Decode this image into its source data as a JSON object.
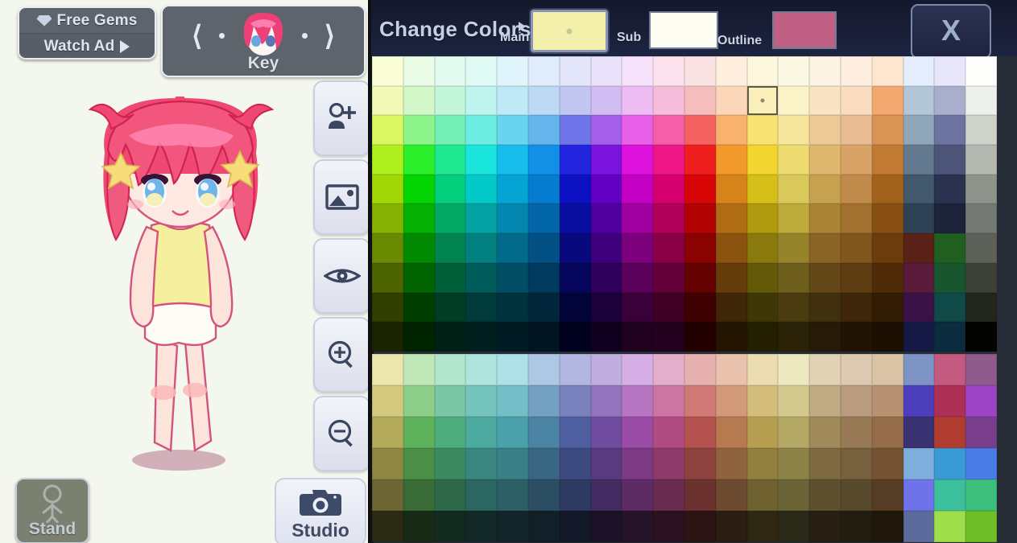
{
  "left_panel": {
    "background_color": "#f4f7ee",
    "free_gems": {
      "label": "Free Gems",
      "sub_label": "Watch Ad",
      "gem_icon": "gem-icon",
      "play_icon": "play-triangle-icon"
    },
    "character_nav": {
      "label": "Key",
      "prev_icon": "chevron-left-icon",
      "next_icon": "chevron-right-icon",
      "avatar_icon": "character-head-avatar"
    },
    "tools": [
      {
        "name": "add-character-button",
        "icon": "person-add-icon"
      },
      {
        "name": "background-image-button",
        "icon": "image-icon"
      },
      {
        "name": "preview-eye-button",
        "icon": "eye-icon"
      },
      {
        "name": "zoom-in-button",
        "icon": "zoom-in-icon"
      },
      {
        "name": "zoom-out-button",
        "icon": "zoom-out-icon"
      }
    ],
    "stand_button": {
      "label": "Stand",
      "icon": "standing-pose-icon"
    },
    "studio_button": {
      "label": "Studio",
      "icon": "camera-icon"
    }
  },
  "color_panel": {
    "title": "Change Colors",
    "close_label": "X",
    "slots": [
      {
        "key": "main",
        "label": "Main",
        "color": "#f3f0ab",
        "selected": true
      },
      {
        "key": "sub",
        "label": "Sub",
        "color": "#fdfdf3",
        "selected": false
      },
      {
        "key": "outline",
        "label": "Outline",
        "color": "#bf5f84",
        "selected": false
      }
    ],
    "selected_swatch": {
      "section": "top",
      "row": 1,
      "col": 12,
      "color": "#fbf3cf"
    },
    "grid": {
      "columns": 20,
      "top_rows": 10,
      "bottom_rows": 6,
      "top": [
        [
          "#fafed6",
          "#eafce5",
          "#e2fbee",
          "#e0fbf6",
          "#e0f4fb",
          "#e0ecfb",
          "#e4e7fb",
          "#eae2fb",
          "#f6e2fb",
          "#fbe2ee",
          "#fbe2e2",
          "#fdeede",
          "#fdf7de",
          "#fbf9e4",
          "#fdf3e2",
          "#fdeedf",
          "#fde6cf",
          "#e4eefc",
          "#e8e6fb",
          "#fdfdfb"
        ],
        [
          "#f2f9b6",
          "#d3f7c9",
          "#c3f5da",
          "#c0f4ef",
          "#bfe9f6",
          "#bdd9f4",
          "#c2c7f2",
          "#d2bdf2",
          "#ecbdf2",
          "#f5bdd9",
          "#f6bdbd",
          "#fbd6b8",
          "#fbf0bb",
          "#fbf3c8",
          "#fae3c2",
          "#fadcc0",
          "#f2a86f",
          "#b3c6d7",
          "#a9aecd",
          "#eef0ec"
        ],
        [
          "#dcf562",
          "#8df58a",
          "#72f0b6",
          "#6deee2",
          "#69d4f0",
          "#65b4ec",
          "#6f74e8",
          "#a35fe8",
          "#e95fe8",
          "#f55fa8",
          "#f56262",
          "#f8b26e",
          "#f8e271",
          "#f5e69b",
          "#ecca96",
          "#e8bd93",
          "#d99455",
          "#8fa7b8",
          "#6d73a0",
          "#ced2cb"
        ],
        [
          "#aef01e",
          "#2bef2b",
          "#1fe891",
          "#1ae5dd",
          "#16bdec",
          "#1190e6",
          "#2225dd",
          "#7a13dd",
          "#dd13dd",
          "#ef1787",
          "#f01f1f",
          "#f29a2b",
          "#f2d62f",
          "#eedc73",
          "#dfb86d",
          "#d9a267",
          "#c07a34",
          "#63798f",
          "#4c5478",
          "#b4b8b0"
        ],
        [
          "#a1d705",
          "#04d504",
          "#04cf7d",
          "#04c9c9",
          "#04a5d5",
          "#057ccf",
          "#0c11c3",
          "#6200c3",
          "#c300c3",
          "#d5006e",
          "#d70505",
          "#d6841a",
          "#d6bf18",
          "#d9c85a",
          "#c6a14f",
          "#bf8a4a",
          "#a2621c",
          "#41586d",
          "#2a3250",
          "#8e938c"
        ],
        [
          "#87b103",
          "#03b003",
          "#03a966",
          "#03a3a3",
          "#0387b1",
          "#0366a9",
          "#0a0e9f",
          "#51009f",
          "#9f009f",
          "#b0005a",
          "#b10303",
          "#b06c12",
          "#b09b10",
          "#bdab3c",
          "#a98434",
          "#a2702f",
          "#884f12",
          "#2e4255",
          "#1d2439",
          "#747973"
        ],
        [
          "#6a8a02",
          "#028a02",
          "#028450",
          "#028080",
          "#026a8a",
          "#025084",
          "#07097d",
          "#3f007d",
          "#7d007d",
          "#8a0047",
          "#8a0202",
          "#8a540e",
          "#8a7a0d",
          "#96842a",
          "#896426",
          "#82561f",
          "#6b3d0c",
          "#5a2118",
          "#215f21",
          "#5d6159"
        ],
        [
          "#4d6401",
          "#016401",
          "#015f3a",
          "#015c5c",
          "#014d64",
          "#013a5f",
          "#05065b",
          "#2e005b",
          "#5b005b",
          "#64003a",
          "#640101",
          "#643d0a",
          "#645909",
          "#6e5e1c",
          "#644717",
          "#5f3d13",
          "#4f2c07",
          "#5a1b3a",
          "#17562f",
          "#3d4139"
        ],
        [
          "#333f01",
          "#013f01",
          "#013c25",
          "#013a3a",
          "#01333f",
          "#01263c",
          "#030439",
          "#1c0039",
          "#390039",
          "#3f0024",
          "#3f0101",
          "#3f2606",
          "#3f3806",
          "#4a3c10",
          "#41300d",
          "#3d2609",
          "#331c04",
          "#3a1248",
          "#0f4948",
          "#23251f"
        ],
        [
          "#1b2300",
          "#002300",
          "#002115",
          "#002020",
          "#001b23",
          "#001521",
          "#01021f",
          "#10001f",
          "#1f001f",
          "#23001d",
          "#230000",
          "#231500",
          "#231f00",
          "#2b2208",
          "#261b06",
          "#221405",
          "#1d0f02",
          "#141a45",
          "#0b2b3e",
          "#030300"
        ]
      ],
      "bottom": [
        [
          "#ece5ac",
          "#c0e7b8",
          "#b2e5cb",
          "#aee4dd",
          "#ade0e7",
          "#adc8e4",
          "#b2b6e0",
          "#c0aee0",
          "#d4aee4",
          "#e3aecb",
          "#e5b0ae",
          "#e8c2ad",
          "#eadcb0",
          "#ece8bf",
          "#e1d2b5",
          "#ddc9b2",
          "#dbc4a6",
          "#7d93c4",
          "#c35a80",
          "#8f5a8c"
        ],
        [
          "#d2c97e",
          "#8dcd8a",
          "#79c7a4",
          "#75c5be",
          "#74bec8",
          "#74a0c1",
          "#7a82bd",
          "#9475bd",
          "#b675c1",
          "#cd75a2",
          "#d07a78",
          "#d29a78",
          "#d4bd7b",
          "#d3c98f",
          "#c0ab82",
          "#b99b7e",
          "#b79172",
          "#4d3fbb",
          "#ad2f55",
          "#9c45c4"
        ],
        [
          "#b3a95b",
          "#5fb25c",
          "#4fac7d",
          "#4caaa1",
          "#4ba1ab",
          "#4b83a4",
          "#4f5fa0",
          "#6f4ca0",
          "#9a4ca6",
          "#b14c83",
          "#b3524f",
          "#b57a4f",
          "#b79f52",
          "#b3a865",
          "#a08a59",
          "#997a56",
          "#956b49",
          "#3a3173",
          "#b13d30",
          "#7a3f8c"
        ],
        [
          "#8e8744",
          "#4a8e47",
          "#3d8962",
          "#3a877f",
          "#397f87",
          "#396682",
          "#3c4a80",
          "#573a80",
          "#7c3a85",
          "#8e3a6a",
          "#8e423f",
          "#90633f",
          "#92803f",
          "#8d8349",
          "#7e6a40",
          "#77603d",
          "#735234",
          "#7eaedc",
          "#3a9bd4",
          "#4a7ce8"
        ],
        [
          "#6b6634",
          "#396b36",
          "#2f6849",
          "#2c6660",
          "#2c6066",
          "#2c4e63",
          "#2e3a62",
          "#422c62",
          "#5e2c65",
          "#6b2c51",
          "#6b3230",
          "#6d4b30",
          "#6f6230",
          "#6a6436",
          "#5e502f",
          "#59492c",
          "#553d26",
          "#6f72e8",
          "#3cbf9b",
          "#3cbf7c"
        ],
        [
          "#2b2a14",
          "#172b16",
          "#132a1e",
          "#122927",
          "#122629",
          "#121f28",
          "#131828",
          "#1b1228",
          "#261229",
          "#2b1221",
          "#2b1413",
          "#2d1e13",
          "#2e2813",
          "#2a2816",
          "#261f12",
          "#221d11",
          "#1f1709",
          "#5b6c9c",
          "#9ede4a",
          "#6fbd27"
        ]
      ]
    }
  }
}
